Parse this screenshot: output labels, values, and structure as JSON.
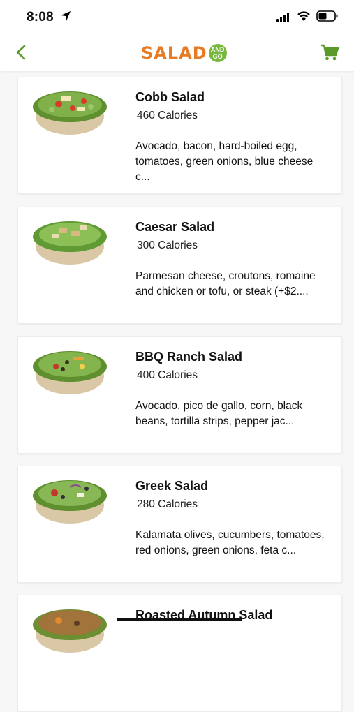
{
  "status_bar": {
    "time": "8:08"
  },
  "header": {
    "logo_text": "SALAD",
    "logo_badge_line1": "AND",
    "logo_badge_line2": "GO"
  },
  "colors": {
    "brand_green": "#5a9a2b",
    "brand_orange": "#e87a22"
  },
  "items": [
    {
      "title": "Cobb Salad",
      "calories": "460 Calories",
      "description": "Avocado, bacon, hard-boiled egg, tomatoes, green onions, blue cheese c..."
    },
    {
      "title": "Caesar Salad",
      "calories": "300 Calories",
      "description": "Parmesan cheese, croutons, romaine and chicken or tofu, or steak (+$2...."
    },
    {
      "title": "BBQ Ranch Salad",
      "calories": "400 Calories",
      "description": "Avocado, pico de gallo, corn, black beans, tortilla strips, pepper jac..."
    },
    {
      "title": "Greek Salad",
      "calories": "280 Calories",
      "description": "Kalamata olives, cucumbers, tomatoes, red onions, green onions, feta c..."
    },
    {
      "title": "Roasted Autumn Salad",
      "calories": "",
      "description": ""
    }
  ]
}
